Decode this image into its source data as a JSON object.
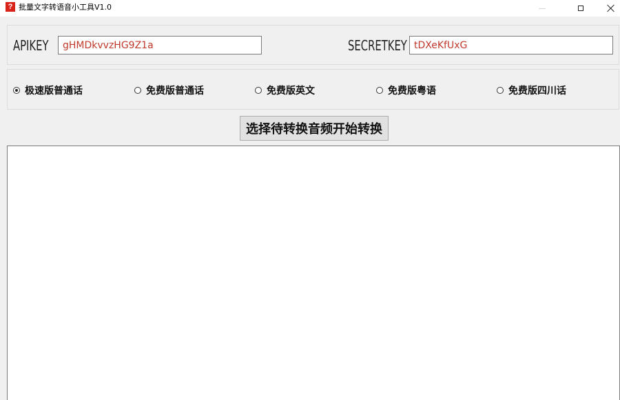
{
  "window": {
    "title": "批量文字转语音小工具V1.0",
    "icon_glyph": "?",
    "icon_color": "#d9241c"
  },
  "keys": {
    "apikey_label": "APIKEY",
    "apikey_value": "gHMDkvvzHG9Z1a",
    "secretkey_label": "SECRETKEY",
    "secretkey_value": "tDXeKfUxG",
    "value_color": "#c0392b"
  },
  "voice_options": [
    {
      "label": "极速版普通话",
      "selected": true
    },
    {
      "label": "免费版普通话",
      "selected": false
    },
    {
      "label": "免费版英文",
      "selected": false
    },
    {
      "label": "免费版粤语",
      "selected": false
    },
    {
      "label": "免费版四川话",
      "selected": false
    }
  ],
  "convert_button_label": "选择待转换音频开始转换",
  "log_text": ""
}
